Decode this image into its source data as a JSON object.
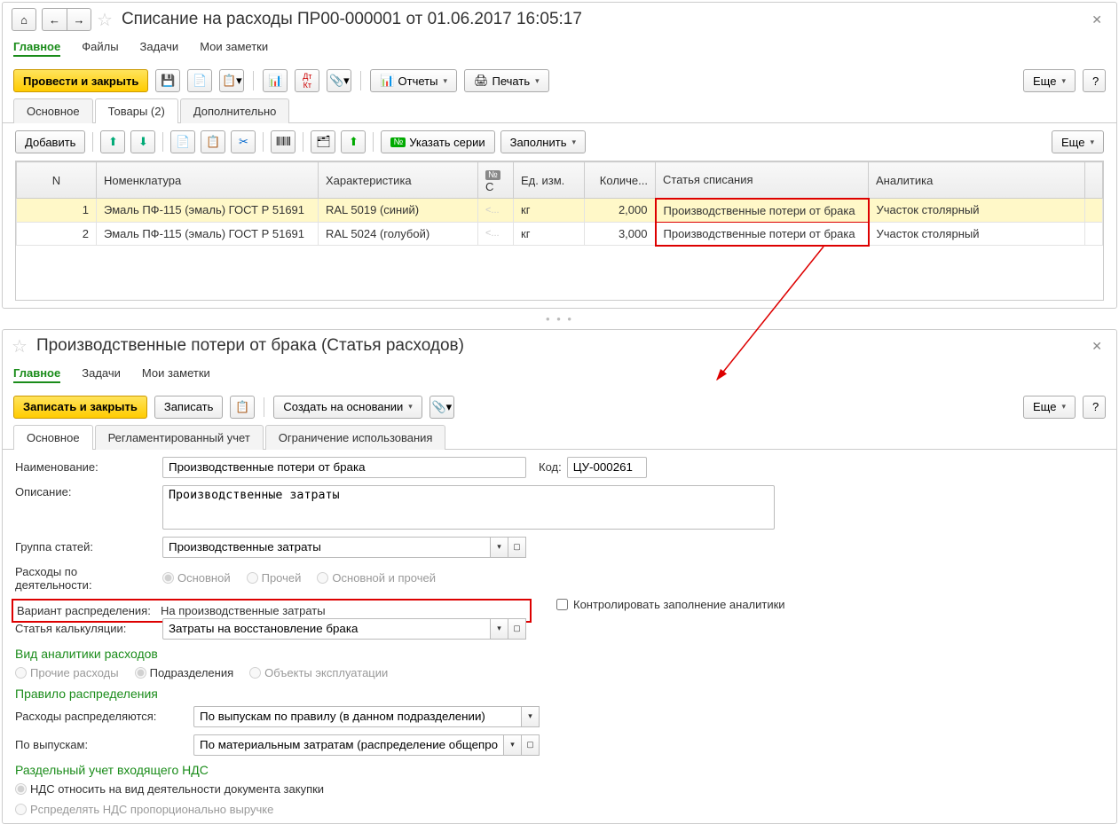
{
  "top": {
    "title": "Списание на расходы ПР00-000001 от 01.06.2017 16:05:17",
    "nav": [
      "Главное",
      "Файлы",
      "Задачи",
      "Мои заметки"
    ],
    "btn_primary": "Провести и закрыть",
    "btn_reports": "Отчеты",
    "btn_print": "Печать",
    "btn_more": "Еще",
    "tabs": [
      "Основное",
      "Товары (2)",
      "Дополнительно"
    ],
    "sub": {
      "add": "Добавить",
      "series": "Указать серии",
      "fill": "Заполнить",
      "more": "Еще"
    },
    "columns": [
      "N",
      "Номенклатура",
      "Характеристика",
      "С",
      "Ед. изм.",
      "Количе...",
      "Статья списания",
      "Аналитика"
    ],
    "rows": [
      {
        "n": "1",
        "item": "Эмаль ПФ-115 (эмаль) ГОСТ Р 51691",
        "char": "RAL 5019 (синий)",
        "s": "<...",
        "unit": "кг",
        "qty": "2,000",
        "article": "Производственные потери от брака",
        "analytics": "Участок столярный"
      },
      {
        "n": "2",
        "item": "Эмаль ПФ-115 (эмаль) ГОСТ Р 51691",
        "char": "RAL 5024 (голубой)",
        "s": "<...",
        "unit": "кг",
        "qty": "3,000",
        "article": "Производственные потери от брака",
        "analytics": "Участок столярный"
      }
    ]
  },
  "bot": {
    "title": "Производственные потери от брака (Статья расходов)",
    "nav": [
      "Главное",
      "Задачи",
      "Мои заметки"
    ],
    "btn_primary": "Записать и закрыть",
    "btn_write": "Записать",
    "btn_create": "Создать на основании",
    "btn_more": "Еще",
    "tabs": [
      "Основное",
      "Регламентированный учет",
      "Ограничение использования"
    ],
    "fields": {
      "name_label": "Наименование:",
      "name_value": "Производственные потери от брака",
      "code_label": "Код:",
      "code_value": "ЦУ-000261",
      "desc_label": "Описание:",
      "desc_value": "Производственные затраты",
      "group_label": "Группа статей:",
      "group_value": "Производственные затраты",
      "activity_label": "Расходы по деятельности:",
      "activity_opts": [
        "Основной",
        "Прочей",
        "Основной и прочей"
      ],
      "dist_label": "Вариант распределения:",
      "dist_value": "На производственные затраты",
      "control_check": "Контролировать заполнение аналитики",
      "calc_label": "Статья калькуляции:",
      "calc_value": "Затраты на восстановление брака"
    },
    "analytics": {
      "head": "Вид аналитики расходов",
      "opts": [
        "Прочие расходы",
        "Подразделения",
        "Объекты эксплуатации"
      ]
    },
    "rule": {
      "head": "Правило распределения",
      "dist_label": "Расходы распределяются:",
      "dist_value": "По выпускам по правилу (в данном подразделении)",
      "by_label": "По выпускам:",
      "by_value": "По материальным затратам (распределение общепроизводс"
    },
    "vat": {
      "head": "Раздельный учет входящего НДС",
      "opt1": "НДС относить на вид деятельности документа закупки",
      "opt2": "Рспределять НДС пропорционально выручке"
    }
  }
}
